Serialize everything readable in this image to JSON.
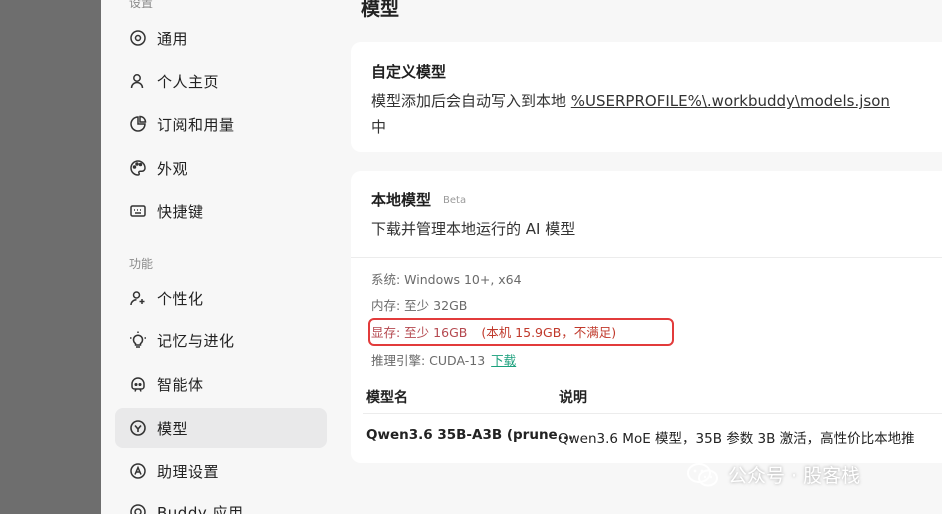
{
  "sidebar": {
    "section_settings": "设置",
    "section_features": "功能",
    "settings_items": [
      {
        "label": "通用",
        "icon": "settings-circle-icon"
      },
      {
        "label": "个人主页",
        "icon": "user-icon"
      },
      {
        "label": "订阅和用量",
        "icon": "pie-chart-icon"
      },
      {
        "label": "外观",
        "icon": "palette-icon"
      },
      {
        "label": "快捷键",
        "icon": "keyboard-icon"
      }
    ],
    "feature_items": [
      {
        "label": "个性化",
        "icon": "user-sparkle-icon"
      },
      {
        "label": "记忆与进化",
        "icon": "lightbulb-icon"
      },
      {
        "label": "智能体",
        "icon": "bot-icon"
      },
      {
        "label": "模型",
        "icon": "model-icon",
        "active": true
      },
      {
        "label": "助理设置",
        "icon": "assistant-icon"
      },
      {
        "label": "Buddy 应用",
        "icon": "app-icon"
      }
    ]
  },
  "main": {
    "title": "模型",
    "custom_model": {
      "title": "自定义模型",
      "desc_prefix": "模型添加后会自动写入到本地 ",
      "path": "%USERPROFILE%\\.workbuddy\\models.json",
      "desc_suffix": "中"
    },
    "local_model": {
      "title": "本地模型",
      "badge": "Beta",
      "desc": "下载并管理本地运行的 AI 模型",
      "requirements": {
        "system": "系统: Windows 10+, x64",
        "memory": "内存: 至少 32GB",
        "vram": "显存: 至少 16GB",
        "vram_note": "(本机 15.9GB，不满足)",
        "engine": "推理引擎: CUDA-13",
        "download_label": "下载"
      },
      "table": {
        "headers": [
          "模型名",
          "说明"
        ],
        "rows": [
          {
            "name": "Qwen3.6 35B-A3B (prune...",
            "desc": "Qwen3.6 MoE 模型，35B 参数 3B 激活，高性价比本地推"
          }
        ]
      }
    }
  },
  "watermark": {
    "text": "公众号 · 股客栈",
    "icon": "wechat-icon"
  },
  "colors": {
    "window_bg": "#f7f7f7",
    "card_bg": "#ffffff",
    "active_nav": "#e9e9ea",
    "warning_red": "#c0392b",
    "highlight_border": "#e23b3b",
    "link_green": "#1aa07c"
  }
}
